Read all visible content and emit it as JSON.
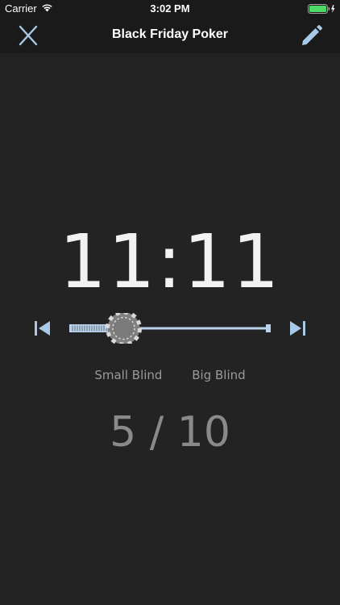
{
  "status_bar": {
    "carrier": "Carrier",
    "time": "3:02 PM",
    "battery_color": "#4cd964"
  },
  "nav": {
    "title": "Black Friday Poker",
    "left_icon": "close-icon",
    "right_icon": "pencil-icon"
  },
  "timer": {
    "display": "11:11"
  },
  "level_slider": {
    "progress": 0.27,
    "thumb_icon": "poker-chip-icon",
    "track_color": "#b9d3ea"
  },
  "blinds": {
    "small_label": "Small Blind",
    "big_label": "Big Blind",
    "value": "5 / 10"
  },
  "controls": {
    "prev_icon": "skip-previous-icon",
    "next_icon": "skip-next-icon",
    "accent_color": "#a9c9e8"
  }
}
